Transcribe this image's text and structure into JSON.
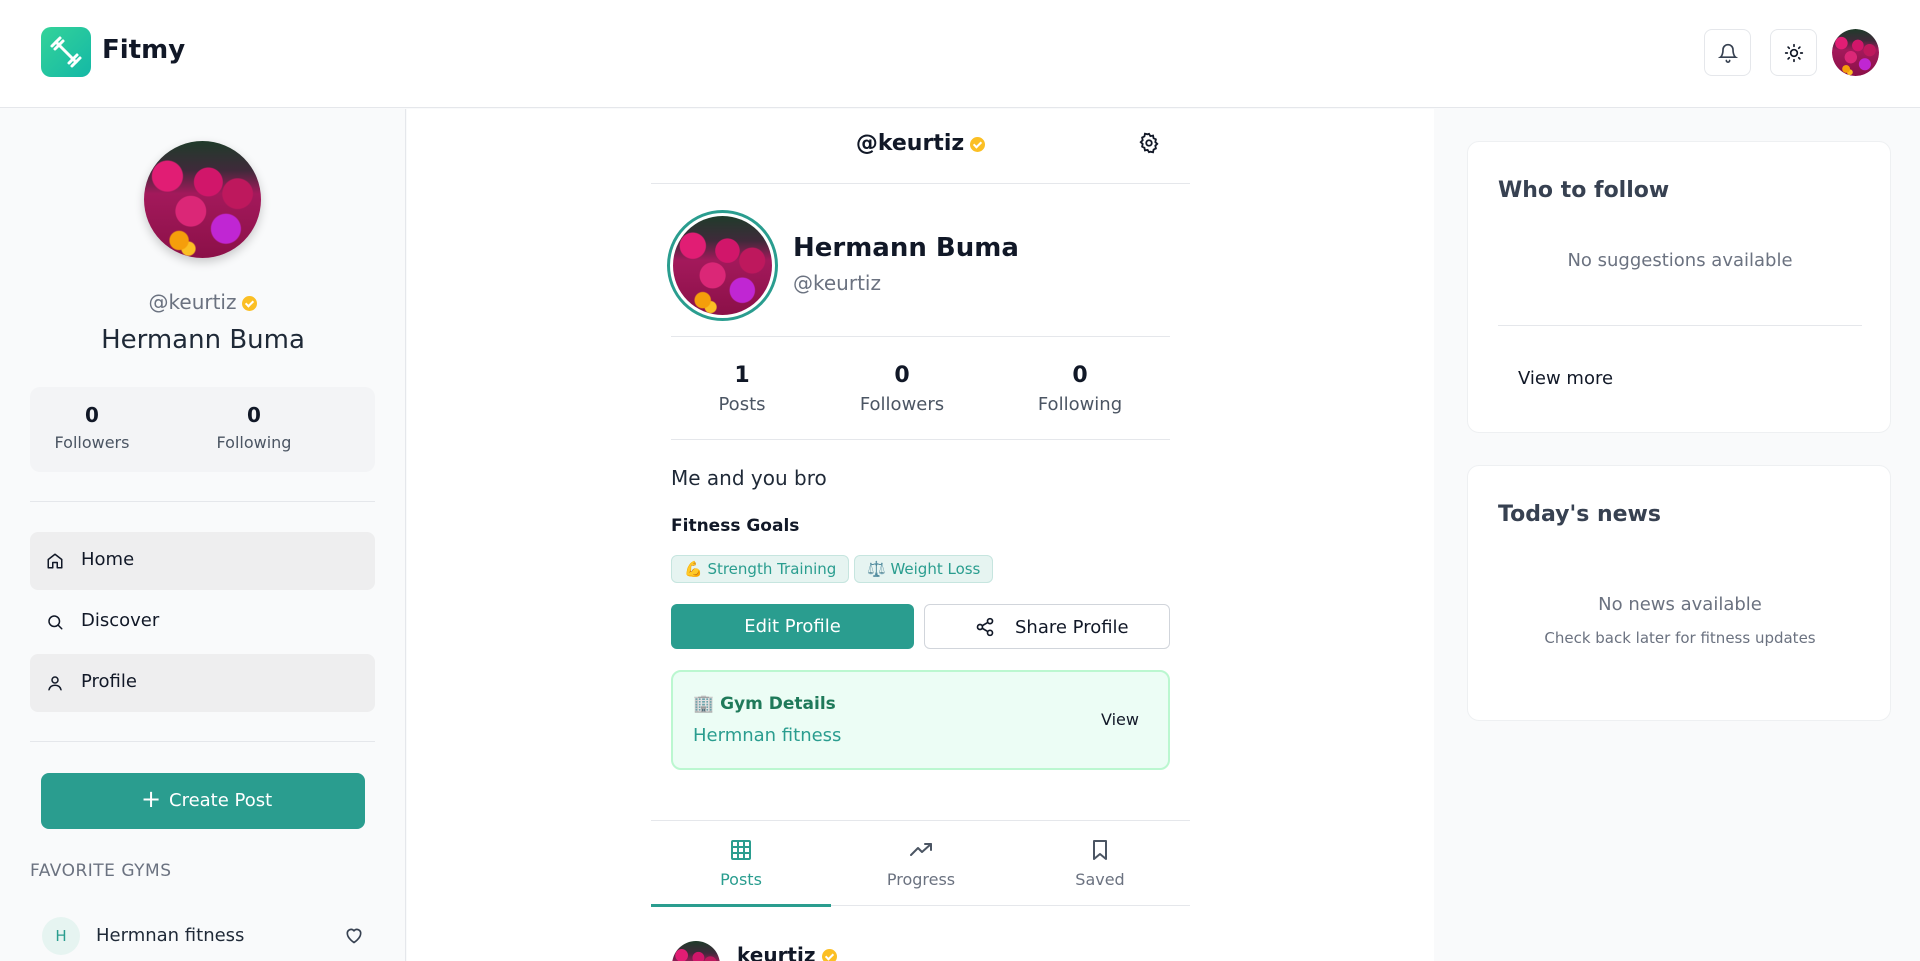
{
  "app": {
    "name": "Fitmy"
  },
  "sidebar": {
    "handle": "@keurtiz",
    "name": "Hermann Buma",
    "stats": {
      "followers_count": "0",
      "followers_label": "Followers",
      "following_count": "0",
      "following_label": "Following"
    },
    "nav": [
      {
        "label": "Home",
        "icon": "home-icon",
        "active": true
      },
      {
        "label": "Discover",
        "icon": "search-icon",
        "active": false
      },
      {
        "label": "Profile",
        "icon": "user-icon",
        "active": true
      }
    ],
    "create_post": "Create Post",
    "favorite_gyms_title": "FAVORITE GYMS",
    "favorite_gyms": [
      {
        "initial": "H",
        "name": "Hermnan fitness"
      }
    ]
  },
  "profile": {
    "header_handle": "@keurtiz",
    "name": "Hermann Buma",
    "handle": "@keurtiz",
    "stats": [
      {
        "value": "1",
        "label": "Posts"
      },
      {
        "value": "0",
        "label": "Followers"
      },
      {
        "value": "0",
        "label": "Following"
      }
    ],
    "bio": "Me and you bro",
    "goals_title": "Fitness Goals",
    "goals": [
      "💪 Strength Training",
      "⚖️ Weight Loss"
    ],
    "edit_button": "Edit Profile",
    "share_button": "Share Profile",
    "gym_card": {
      "title": "🏢 Gym Details",
      "gym_name": "Hermnan fitness",
      "view": "View"
    },
    "tabs": [
      {
        "label": "Posts",
        "icon": "grid-icon",
        "active": true
      },
      {
        "label": "Progress",
        "icon": "trending-up-icon",
        "active": false
      },
      {
        "label": "Saved",
        "icon": "bookmark-icon",
        "active": false
      }
    ],
    "first_post_author": "keurtiz"
  },
  "right": {
    "who_to_follow": {
      "title": "Who to follow",
      "empty": "No suggestions available",
      "view_more": "View more"
    },
    "news": {
      "title": "Today's news",
      "empty": "No news available",
      "sub": "Check back later for fitness updates"
    }
  },
  "colors": {
    "accent": "#2a9d8f",
    "verified": "#fbbf24",
    "gym_card_bg": "#ecfdf5"
  }
}
